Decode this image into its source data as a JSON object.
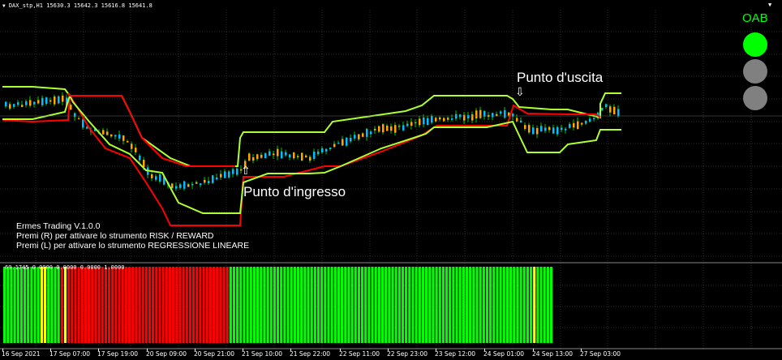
{
  "header": {
    "symbol_timeframe": "DAX_stp,H1",
    "ohlc": "15630.3 15642.3 15616.8 15641.8"
  },
  "window_controls": {
    "dropdown_glyph": "▼"
  },
  "colors": {
    "background": "#000000",
    "grid": "#5a5a5a",
    "upper_channel": "#adff2f",
    "lower_channel": "#ff0000",
    "bull_candle": "#00bfff",
    "bear_candle": "#ffa500",
    "wick": "#00ff00",
    "histogram_green": "#00ff00",
    "histogram_red": "#ff0000",
    "histogram_yellow": "#ffff00",
    "oab_label": "#00ff00",
    "oab_active": "#00ff00",
    "oab_inactive": "#808080"
  },
  "panel": {
    "oab_label": "OAB",
    "lights": [
      {
        "name": "green",
        "active": true
      },
      {
        "name": "grey-1",
        "active": false
      },
      {
        "name": "grey-2",
        "active": false
      }
    ]
  },
  "annotations": {
    "exit_label": "Punto d'uscita",
    "entry_label": "Punto d'ingresso",
    "exit_arrow": "⇩",
    "entry_arrow": "⇧"
  },
  "info": {
    "line1": "Ermes Trading  V.1.0.0",
    "line2": "Premi (R) per attivare lo strumento RISK / REWARD",
    "line3": "Premi (L) per attivare lo strumento REGRESSIONE LINEARE"
  },
  "indicator": {
    "label": "69.1745 0.0000 0.0000 0.0000 1.0000"
  },
  "x_axis": {
    "labels": [
      "16 Sep 2021",
      "17 Sep 07:00",
      "17 Sep 19:00",
      "20 Sep 09:00",
      "20 Sep 21:00",
      "21 Sep 10:00",
      "21 Sep 22:00",
      "22 Sep 11:00",
      "22 Sep 23:00",
      "23 Sep 12:00",
      "24 Sep 01:00",
      "24 Sep 13:00",
      "27 Sep 03:00"
    ]
  },
  "histogram": {
    "segments": [
      {
        "color": "green",
        "bars": 11
      },
      {
        "color": "yellow",
        "bars": 2
      },
      {
        "color": "green",
        "bars": 4
      },
      {
        "color": "red",
        "bars": 1
      },
      {
        "color": "yellow",
        "bars": 1
      },
      {
        "color": "red",
        "bars": 48
      },
      {
        "color": "green",
        "bars": 90
      },
      {
        "color": "yellow",
        "bars": 1
      },
      {
        "color": "green",
        "bars": 5
      }
    ]
  }
}
